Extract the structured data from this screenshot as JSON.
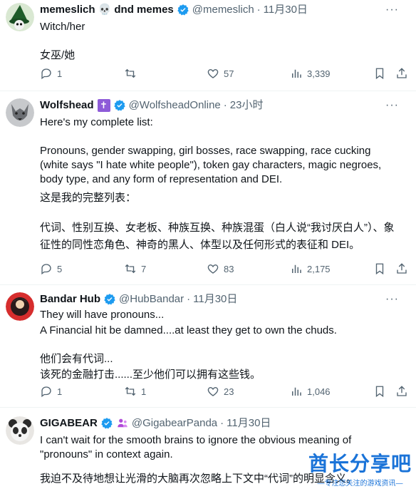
{
  "colors": {
    "verified": "#1d9bf0",
    "muted": "#536471",
    "divider": "#eff3f4",
    "watermark": "#1a73d8"
  },
  "tweets": [
    {
      "name": "memeslich",
      "name_suffix": "💀 dnd memes",
      "handle": "@memeslich",
      "time": "11月30日",
      "lines": [
        "Witch/her",
        "",
        "女巫/她"
      ],
      "reply": "1",
      "retweet": "",
      "like": "57",
      "views": "3,339"
    },
    {
      "name": "Wolfshead",
      "name_suffix": "✝",
      "handle": "@WolfsheadOnline",
      "time": "23小时",
      "lines": [
        "Here's my complete list:",
        "",
        "Pronouns, gender swapping, girl bosses, race swapping, race cucking",
        "(white says \"I hate white people\"), token gay characters, magic negroes,",
        "body type, and any form of representation and DEI.",
        "这是我的完整列表：",
        "",
        "代词、性别互换、女老板、种族互换、种族混蛋（白人说“我讨厌白人”）、象",
        "征性的同性恋角色、神奇的黑人、体型以及任何形式的表征和 DEI。"
      ],
      "reply": "5",
      "retweet": "7",
      "like": "83",
      "views": "2,175"
    },
    {
      "name": "Bandar Hub",
      "name_suffix": "",
      "handle": "@HubBandar",
      "time": "11月30日",
      "lines": [
        "They will have pronouns...",
        "A Financial hit be damned....at least they get to own the chuds.",
        "",
        "他们会有代词...",
        "该死的金融打击......至少他们可以拥有这些钱。"
      ],
      "reply": "1",
      "retweet": "1",
      "like": "23",
      "views": "1,046"
    },
    {
      "name": "GIGABEAR",
      "name_suffix": "",
      "handle": "@GigabearPanda",
      "time": "11月30日",
      "lines": [
        "I can't wait for the smooth brains to ignore the obvious meaning of",
        "\"pronouns\" in context again.",
        "",
        "我迫不及待地想让光滑的大脑再次忽略上下文中“代词”的明显含义。"
      ]
    }
  ],
  "watermark": {
    "main": "酋长分享吧",
    "sub": "—专注您关注的游戏资讯—"
  }
}
